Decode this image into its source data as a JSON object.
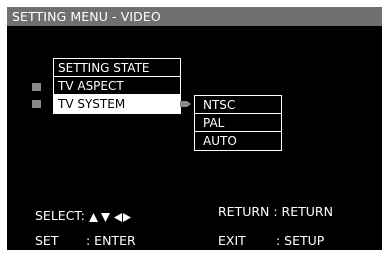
{
  "title": "SETTING MENU - VIDEO",
  "menu": {
    "items": [
      {
        "label": "SETTING STATE"
      },
      {
        "label": "TV ASPECT"
      },
      {
        "label": "TV SYSTEM"
      }
    ],
    "selected": "TV SYSTEM"
  },
  "submenu": {
    "items": [
      {
        "label": "NTSC"
      },
      {
        "label": "PAL"
      },
      {
        "label": "AUTO"
      }
    ]
  },
  "help": {
    "select_label": "SELECT:",
    "arrow_icons": [
      "up-triangle-icon",
      "down-triangle-icon",
      "left-triangle-icon",
      "right-triangle-icon"
    ],
    "return_text": "RETURN : RETURN",
    "set_label": "SET",
    "enter_text": ": ENTER",
    "exit_label": "EXIT",
    "setup_text": ": SETUP"
  },
  "colors": {
    "background": "#000000",
    "titlebar": "#6f6f6f",
    "highlight": "#ffffff",
    "bullet": "#8a8a8a",
    "text": "#ffffff"
  }
}
